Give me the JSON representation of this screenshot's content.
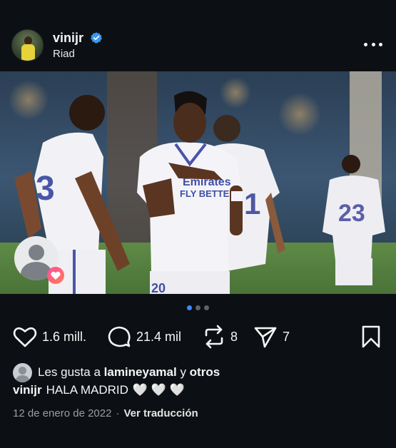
{
  "post": {
    "username": "vinijr",
    "location": "Riad",
    "verified_icon": "verified-badge-icon",
    "more_icon": "more-options-icon"
  },
  "carousel": {
    "dots": 3,
    "active_index": 0
  },
  "actions": {
    "like_count": "1.6 mill.",
    "comment_count": "21.4 mil",
    "repost_count": "8",
    "share_count": "7"
  },
  "likes": {
    "prefix": "Les gusta a",
    "user": "lamineyamal",
    "joiner": "y",
    "others": "otros"
  },
  "caption": {
    "username": "vinijr",
    "text": "HALA MADRID",
    "hearts": "🤍 🤍 🤍"
  },
  "meta": {
    "date": "12 de enero de 2022",
    "separator": "·",
    "translate": "Ver traducción"
  },
  "colors": {
    "background": "#0c1014",
    "accent_blue": "#3e88ff",
    "verified_blue": "#3897f0",
    "muted": "#9a9ea3"
  }
}
